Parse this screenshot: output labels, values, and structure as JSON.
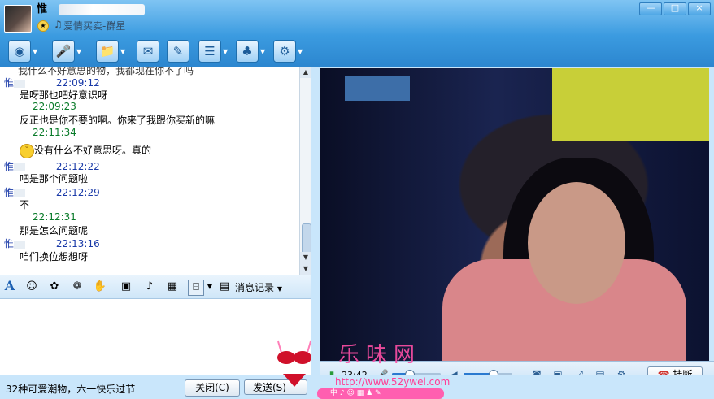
{
  "window": {
    "contact_name": "惟",
    "status_text": "爱情买卖-群星",
    "controls": [
      "—",
      "□",
      "×"
    ]
  },
  "toolbar": {
    "icons": [
      "video-call-icon",
      "voice-call-icon",
      "send-file-icon",
      "send-mail-icon",
      "sms-icon",
      "app-icon",
      "remote-assist-icon",
      "settings-icon"
    ]
  },
  "chat": {
    "partial_line": "我什么不好意思的物，我都现在你不了吗",
    "messages": [
      {
        "sender": "惟",
        "time": "22:09:12",
        "text": "是呀那也吧好意识呀"
      },
      {
        "sender": "",
        "time": "22:09:23",
        "text": "反正也是你不要的啊。你来了我跟你买新的嘛"
      },
      {
        "sender": "",
        "time": "22:11:34",
        "text": "没有什么不好意思呀。真的"
      },
      {
        "sender": "惟",
        "time": "22:12:22",
        "text": "吧是那个问题啦"
      },
      {
        "sender": "惟",
        "time": "22:12:29",
        "text": "不"
      },
      {
        "sender": "",
        "time": "22:12:31",
        "text": "那是怎么问题呢"
      },
      {
        "sender": "惟",
        "time": "22:13:16",
        "text": "咱们换位想想呀"
      }
    ]
  },
  "format_bar": {
    "font_label": "A",
    "history_label": "消息记录"
  },
  "bottom": {
    "status_text": "32种可爱潮物，六一快乐过节",
    "close_label": "关闭(C)",
    "send_label": "发送(S)"
  },
  "video_controls": {
    "elapsed": "23:42",
    "mic_level": 0.35,
    "speaker_level": 0.6,
    "hangup_label": "挂断"
  },
  "watermark": {
    "logo_text": "乐味网",
    "url": "http://www.52ywei.com",
    "bar_text": "中"
  },
  "colors": {
    "title_bar": "#3b9be0",
    "time_blue": "#1a3aa8",
    "time_green": "#0a7b2a",
    "watermark_pink": "#ff3d95"
  }
}
